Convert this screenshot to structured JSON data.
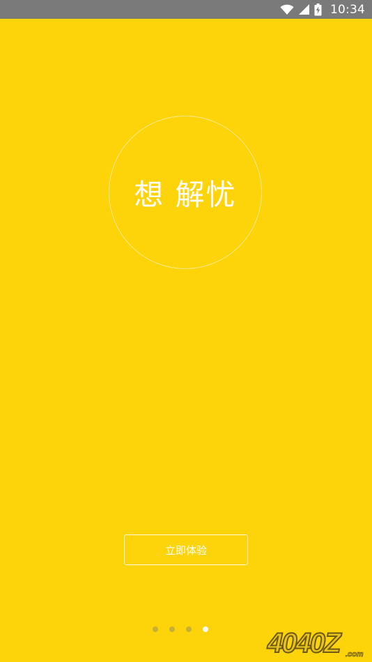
{
  "status_bar": {
    "time": "10:34",
    "icons": [
      "wifi-icon",
      "cellular-signal-icon",
      "battery-charging-icon"
    ]
  },
  "onboarding": {
    "circle_text": "想 解忧",
    "start_button_label": "立即体验",
    "pages_total": 4,
    "current_page": 4
  },
  "watermark": {
    "text": "4040Z",
    "subtext": ".com"
  },
  "colors": {
    "background": "#FDD309",
    "status_bar": "#7A7A7A",
    "text": "#FFFFFF"
  }
}
